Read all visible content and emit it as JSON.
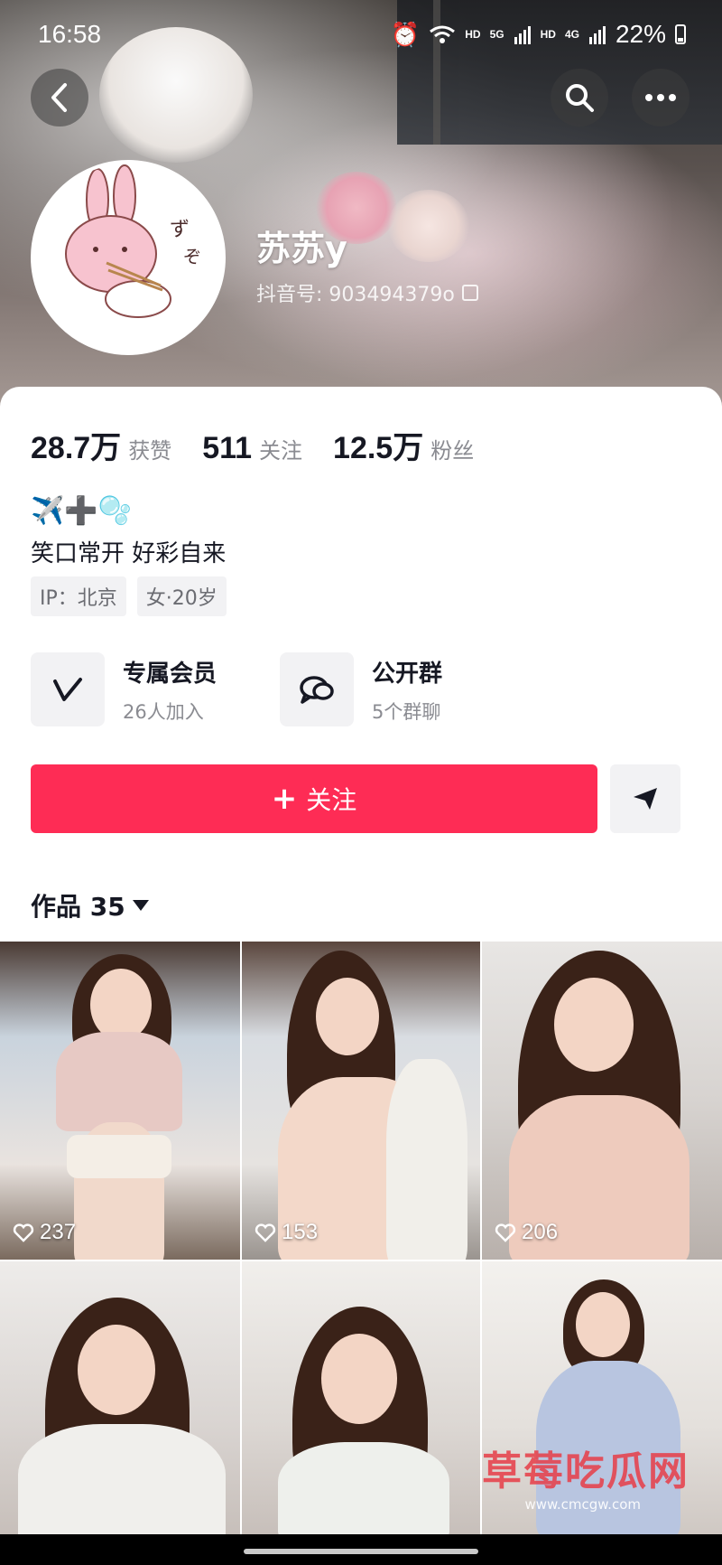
{
  "status_bar": {
    "time": "16:58",
    "network_1": "HD",
    "network_2_top": "5G",
    "network_2": "HD",
    "network_3_top": "4G",
    "battery": "22%"
  },
  "profile": {
    "name": "苏苏y",
    "douyin_id": "抖音号: 903494379o"
  },
  "stats": [
    {
      "value": "28.7万",
      "label": "获赞"
    },
    {
      "value": "511",
      "label": "关注"
    },
    {
      "value": "12.5万",
      "label": "粉丝"
    }
  ],
  "bio": {
    "emojis": "✈️➕🫧",
    "text": "笑口常开 好彩自来",
    "tags": [
      "IP：北京",
      "女·20岁"
    ]
  },
  "features": [
    {
      "title": "专属会员",
      "subtitle": "26人加入",
      "icon": "vip-v-icon"
    },
    {
      "title": "公开群",
      "subtitle": "5个群聊",
      "icon": "chat-bubbles-icon"
    }
  ],
  "actions": {
    "follow_label": "关注",
    "share_icon": "share-arrow-icon"
  },
  "works": {
    "label": "作品 35"
  },
  "videos": [
    {
      "likes": "237"
    },
    {
      "likes": "153"
    },
    {
      "likes": "206"
    },
    {
      "likes": ""
    },
    {
      "likes": ""
    },
    {
      "likes": ""
    }
  ],
  "watermark": {
    "title": "草莓吃瓜网",
    "url": "www.cmcgw.com"
  },
  "colors": {
    "follow_red": "#fe2c55",
    "text_primary": "#161823",
    "text_secondary": "#8a8b91"
  }
}
